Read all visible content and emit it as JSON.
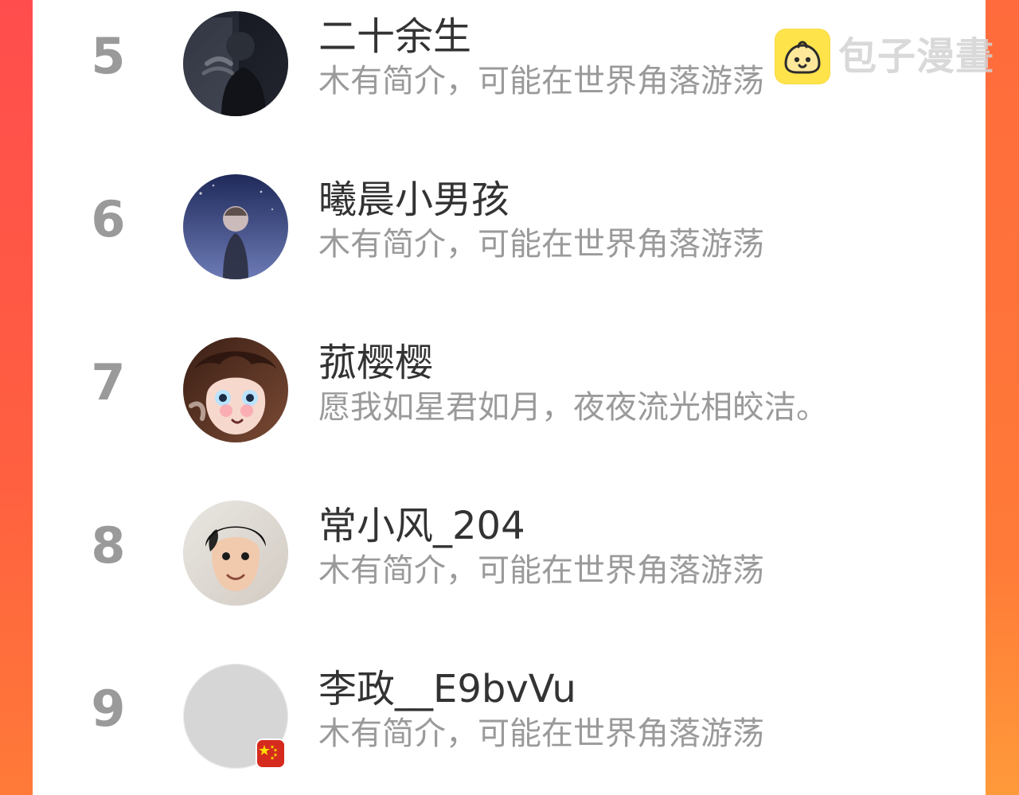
{
  "watermark": {
    "text": "包子漫畫",
    "icon": "baozi-icon",
    "icon_color": "#ffe34a"
  },
  "leaderboard": [
    {
      "rank": "5",
      "name": "二十余生",
      "bio": "木有简介，可能在世界角落游荡",
      "avatar": "smoking-man-photo"
    },
    {
      "rank": "6",
      "name": "曦晨小男孩",
      "bio": "木有简介，可能在世界角落游荡",
      "avatar": "night-sky-illustration"
    },
    {
      "rank": "7",
      "name": "菰樱樱",
      "bio": "愿我如星君如月，夜夜流光相皎洁。",
      "avatar": "anime-girl-illustration"
    },
    {
      "rank": "8",
      "name": "常小风_204",
      "bio": "木有简介，可能在世界角落游荡",
      "avatar": "young-man-photo"
    },
    {
      "rank": "9",
      "name": "李政__E9bvVu",
      "bio": "木有简介，可能在世界角落游荡",
      "avatar": "default-gray-avatar",
      "badge": "china-flag-icon"
    }
  ],
  "colors": {
    "rank_text": "#9a9a9a",
    "name_text": "#333333",
    "bio_text": "#9a9a9a",
    "panel_bg": "#ffffff",
    "border_gradient_top": "#ff4d4d",
    "border_gradient_bottom": "#ff9a3a"
  }
}
